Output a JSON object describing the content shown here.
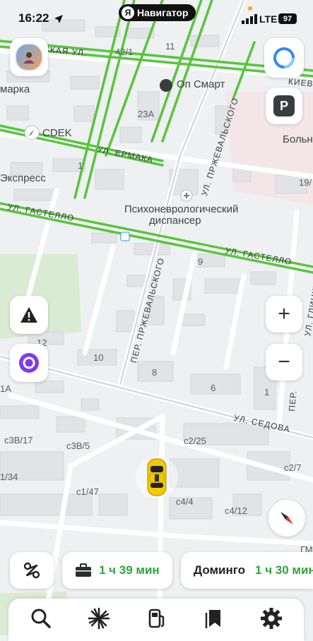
{
  "status_bar": {
    "time": "16:22",
    "app_name": "Навигатор",
    "app_logo_letter": "Я",
    "network": "LTE",
    "battery": "97"
  },
  "map": {
    "streets": {
      "kievskaya": "КИЕВСКАЯ УЛ.",
      "kievskaya_right": "КИЕВ",
      "ermaka": "УЛ. ЕРМАКА",
      "gastello_left": "УЛ. ГАСТЕЛЛО",
      "gastello_right": "УЛ. ГАСТЕЛЛО",
      "przhevalskogo_ul": "УЛ. ПРЖЕВАЛЬСКОГО",
      "przhevalskogo_per": "ПЕР. ПРЖЕВАЛЬСКОГО",
      "sedova": "УЛ. СЕДОВА",
      "glinki": "УЛ. ГЛИНКИ",
      "per_right": "ПЕР."
    },
    "pois": {
      "on_smart": "Оп Смарт",
      "cdek": "CDEK",
      "dispanser_line1": "Психоневрологический",
      "dispanser_line2": "диспансер",
      "express": "Экспресс",
      "bolni": "Больн",
      "marka": "марка"
    },
    "house_numbers": {
      "n42_1": "42/1",
      "n11": "11",
      "n23a": "23А",
      "n1": "1",
      "n19": "19/",
      "n9": "9",
      "n12": "12",
      "n10": "10",
      "n8": "8",
      "n6": "6",
      "n1a": "1А",
      "n1r": "1",
      "c3v17": "с3В/17",
      "c3v5": "с3В/5",
      "c2_25": "с2/25",
      "c2_7": "с2/7",
      "n1_34": "1/34",
      "c1_47": "с1/47",
      "c4_4": "с4/4",
      "c4_12": "с4/12",
      "gm": "ГМ"
    }
  },
  "controls": {
    "parking_label": "P",
    "zoom_in": "+",
    "zoom_out": "−"
  },
  "routes": {
    "work_time": "1 ч 39 мин",
    "home_name": "Доминго",
    "home_time": "1 ч 30 мин"
  },
  "colors": {
    "traffic_green": "#58c53d",
    "accent_blue": "#2f8bf0",
    "alice_purple": "#7a3cf0",
    "route_time_green": "#2fa43b",
    "car_yellow": "#f5c800"
  },
  "icons": {
    "search": "search-icon",
    "navigator": "navigator-icon",
    "gas": "gas-station-icon",
    "bookmarks": "bookmarks-icon",
    "settings": "gear-icon"
  }
}
